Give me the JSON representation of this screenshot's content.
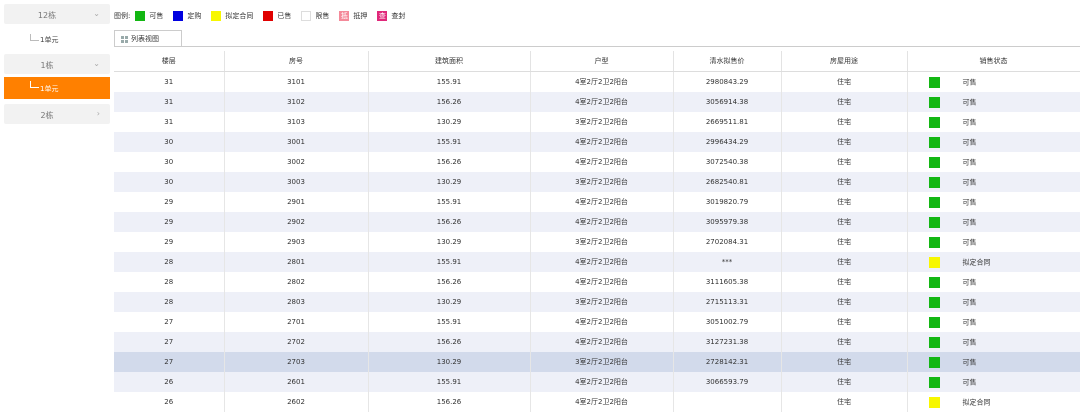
{
  "sidebar": {
    "items": [
      {
        "label": "12栋",
        "chevron": "⌄"
      },
      {
        "sub_label": "1单元"
      },
      {
        "label": "1栋",
        "chevron": "⌄"
      },
      {
        "sub_label": "1单元",
        "active": true
      },
      {
        "label": "2栋",
        "chevron": "›"
      }
    ]
  },
  "legend": {
    "title": "图例:",
    "items": [
      {
        "label": "可售",
        "color": "#13b713"
      },
      {
        "label": "定购",
        "color": "#0000e0"
      },
      {
        "label": "拟定合同",
        "color": "#f7f700"
      },
      {
        "label": "已售",
        "color": "#e00000"
      },
      {
        "label": "限售",
        "color": "#ffffff"
      },
      {
        "label": "抵押",
        "color": "#f48a9a",
        "glyph": "抵"
      },
      {
        "label": "查封",
        "color": "#e0287a",
        "glyph": "查"
      }
    ]
  },
  "tab": {
    "label": "列表视图"
  },
  "table": {
    "columns": [
      "楼层",
      "房号",
      "建筑面积",
      "户型",
      "清水拟售价",
      "房屋用途",
      "销售状态"
    ],
    "rows": [
      [
        "31",
        "3101",
        "155.91",
        "4室2厅2卫2阳台",
        "2980843.29",
        "住宅",
        "可售",
        "#13b713"
      ],
      [
        "31",
        "3102",
        "156.26",
        "4室2厅2卫2阳台",
        "3056914.38",
        "住宅",
        "可售",
        "#13b713"
      ],
      [
        "31",
        "3103",
        "130.29",
        "3室2厅2卫2阳台",
        "2669511.81",
        "住宅",
        "可售",
        "#13b713"
      ],
      [
        "30",
        "3001",
        "155.91",
        "4室2厅2卫2阳台",
        "2996434.29",
        "住宅",
        "可售",
        "#13b713"
      ],
      [
        "30",
        "3002",
        "156.26",
        "4室2厅2卫2阳台",
        "3072540.38",
        "住宅",
        "可售",
        "#13b713"
      ],
      [
        "30",
        "3003",
        "130.29",
        "3室2厅2卫2阳台",
        "2682540.81",
        "住宅",
        "可售",
        "#13b713"
      ],
      [
        "29",
        "2901",
        "155.91",
        "4室2厅2卫2阳台",
        "3019820.79",
        "住宅",
        "可售",
        "#13b713"
      ],
      [
        "29",
        "2902",
        "156.26",
        "4室2厅2卫2阳台",
        "3095979.38",
        "住宅",
        "可售",
        "#13b713"
      ],
      [
        "29",
        "2903",
        "130.29",
        "3室2厅2卫2阳台",
        "2702084.31",
        "住宅",
        "可售",
        "#13b713"
      ],
      [
        "28",
        "2801",
        "155.91",
        "4室2厅2卫2阳台",
        "***",
        "住宅",
        "拟定合同",
        "#f7f700"
      ],
      [
        "28",
        "2802",
        "156.26",
        "4室2厅2卫2阳台",
        "3111605.38",
        "住宅",
        "可售",
        "#13b713"
      ],
      [
        "28",
        "2803",
        "130.29",
        "3室2厅2卫2阳台",
        "2715113.31",
        "住宅",
        "可售",
        "#13b713"
      ],
      [
        "27",
        "2701",
        "155.91",
        "4室2厅2卫2阳台",
        "3051002.79",
        "住宅",
        "可售",
        "#13b713"
      ],
      [
        "27",
        "2702",
        "156.26",
        "4室2厅2卫2阳台",
        "3127231.38",
        "住宅",
        "可售",
        "#13b713"
      ],
      [
        "27",
        "2703",
        "130.29",
        "3室2厅2卫2阳台",
        "2728142.31",
        "住宅",
        "可售",
        "#13b713"
      ],
      [
        "26",
        "2601",
        "155.91",
        "4室2厅2卫2阳台",
        "3066593.79",
        "住宅",
        "可售",
        "#13b713"
      ],
      [
        "26",
        "2602",
        "156.26",
        "4室2厅2卫2阳台",
        "",
        "住宅",
        "拟定合同",
        "#f7f700"
      ]
    ],
    "selected_row": 14
  }
}
